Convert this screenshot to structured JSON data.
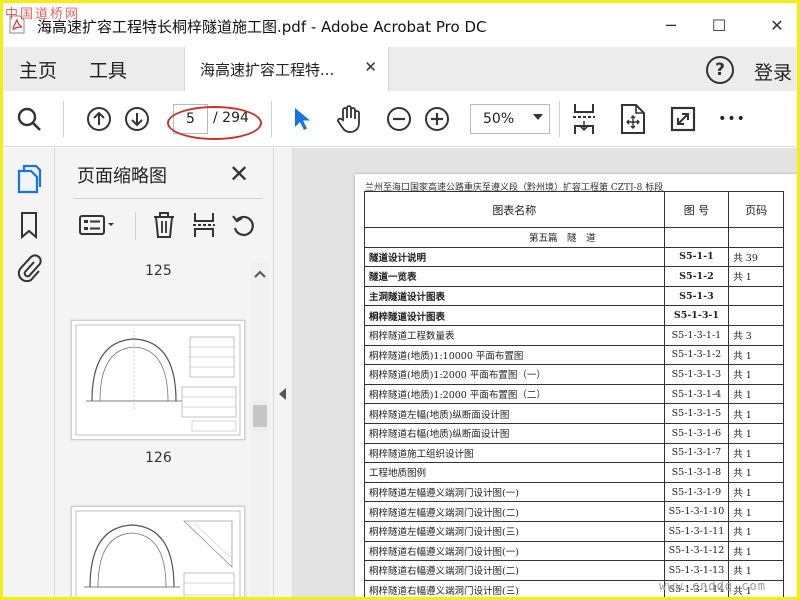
{
  "watermark_top": "中国道桥网",
  "watermark_bottom": "www.cnddq.com",
  "window": {
    "title": "海高速扩容工程特长桐梓隧道施工图.pdf - Adobe Acrobat Pro DC",
    "minimize": "─",
    "maximize": "☐",
    "close": "✕"
  },
  "nav": {
    "home": "主页",
    "tools": "工具",
    "doc_tab": "海高速扩容工程特...",
    "doc_tab_close": "✕",
    "help": "?",
    "login": "登录"
  },
  "toolbar": {
    "page_current": "5",
    "page_total": "/ 294",
    "zoom": "50%",
    "more": "•••"
  },
  "thumbnails": {
    "title": "页面缩略图",
    "close": "✕",
    "pages": [
      "125",
      "126"
    ]
  },
  "document": {
    "header": "兰州至海口国家高速公路重庆至遵义段（黔州境）扩容工程第 CZTJ-8 标段",
    "columns": [
      "图表名称",
      "图 号",
      "页码"
    ],
    "section": "第五篇　隧　道",
    "rows": [
      {
        "name": "隧道设计说明",
        "no": "S5-1-1",
        "pages": "共 39",
        "bold": true
      },
      {
        "name": "隧道一览表",
        "no": "S5-1-2",
        "pages": "共 1",
        "bold": true
      },
      {
        "name": "主洞隧道设计图表",
        "no": "S5-1-3",
        "pages": "",
        "bold": true
      },
      {
        "name": "桐梓隧道设计图表",
        "no": "S5-1-3-1",
        "pages": "",
        "bold": true
      },
      {
        "name": "桐梓隧道工程数量表",
        "no": "S5-1-3-1-1",
        "pages": "共 3",
        "bold": false
      },
      {
        "name": "桐梓隧道(地质)1:10000 平面布置图",
        "no": "S5-1-3-1-2",
        "pages": "共 1",
        "bold": false
      },
      {
        "name": "桐梓隧道(地质)1:2000 平面布置图（一）",
        "no": "S5-1-3-1-3",
        "pages": "共 1",
        "bold": false
      },
      {
        "name": "桐梓隧道(地质)1:2000 平面布置图（二）",
        "no": "S5-1-3-1-4",
        "pages": "共 1",
        "bold": false
      },
      {
        "name": "桐梓隧道左幅(地质)纵断面设计图",
        "no": "S5-1-3-1-5",
        "pages": "共 1",
        "bold": false
      },
      {
        "name": "桐梓隧道右幅(地质)纵断面设计图",
        "no": "S5-1-3-1-6",
        "pages": "共 1",
        "bold": false
      },
      {
        "name": "桐梓隧道施工组织设计图",
        "no": "S5-1-3-1-7",
        "pages": "共 1",
        "bold": false
      },
      {
        "name": "工程地质图例",
        "no": "S5-1-3-1-8",
        "pages": "共 1",
        "bold": false
      },
      {
        "name": "桐梓隧道左幅遵义端洞门设计图(一)",
        "no": "S5-1-3-1-9",
        "pages": "共 1",
        "bold": false
      },
      {
        "name": "桐梓隧道左幅遵义端洞门设计图(二)",
        "no": "S5-1-3-1-10",
        "pages": "共 1",
        "bold": false
      },
      {
        "name": "桐梓隧道左幅遵义端洞门设计图(三)",
        "no": "S5-1-3-1-11",
        "pages": "共 1",
        "bold": false
      },
      {
        "name": "桐梓隧道右幅遵义端洞门设计图(一)",
        "no": "S5-1-3-1-12",
        "pages": "共 1",
        "bold": false
      },
      {
        "name": "桐梓隧道右幅遵义端洞门设计图(二)",
        "no": "S5-1-3-1-13",
        "pages": "共 1",
        "bold": false
      },
      {
        "name": "桐梓隧道右幅遵义端洞门设计图(三)",
        "no": "S5-1-3-1-14",
        "pages": "共 1",
        "bold": false
      }
    ]
  },
  "colors": {
    "frame": "#f2ec1b",
    "cursor_blue": "#1473e6",
    "annotation_red": "#c8332b",
    "acrobat_red": "#d8302a"
  }
}
